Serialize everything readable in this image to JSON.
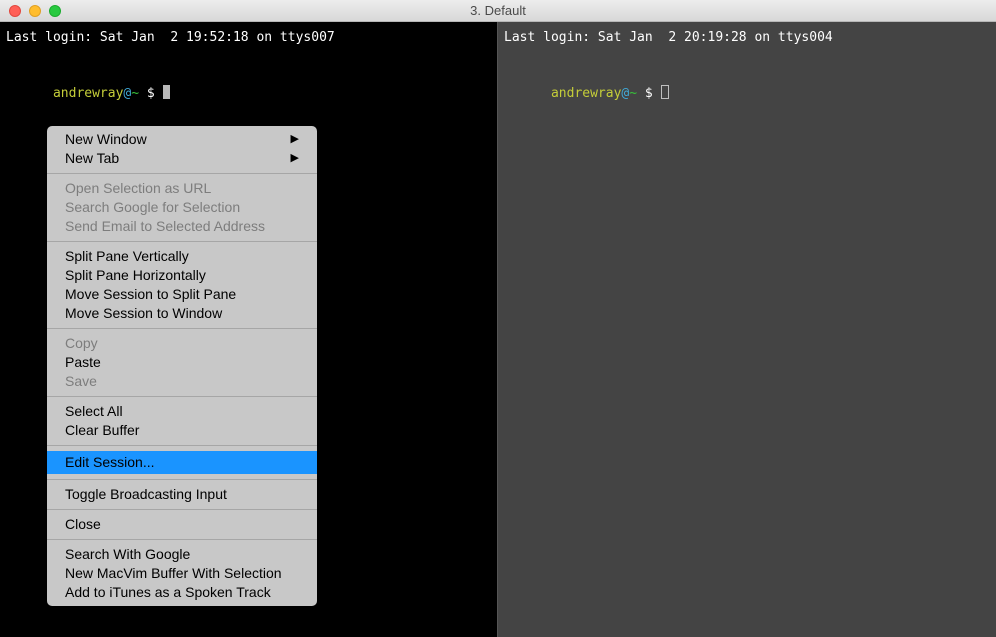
{
  "window": {
    "title": "3. Default"
  },
  "left_pane": {
    "login_line": "Last login: Sat Jan  2 19:52:18 on ttys007",
    "prompt_user": "andrewray",
    "prompt_at": "@",
    "prompt_tilde": "~",
    "prompt_dollar": " $ "
  },
  "right_pane": {
    "login_line": "Last login: Sat Jan  2 20:19:28 on ttys004",
    "prompt_user": "andrewray",
    "prompt_at": "@",
    "prompt_tilde": "~",
    "prompt_dollar": " $ "
  },
  "menu": {
    "groups": [
      [
        {
          "label": "New Window",
          "submenu": true,
          "disabled": false
        },
        {
          "label": "New Tab",
          "submenu": true,
          "disabled": false
        }
      ],
      [
        {
          "label": "Open Selection as URL",
          "disabled": true
        },
        {
          "label": "Search Google for Selection",
          "disabled": true
        },
        {
          "label": "Send Email to Selected Address",
          "disabled": true
        }
      ],
      [
        {
          "label": "Split Pane Vertically",
          "disabled": false
        },
        {
          "label": "Split Pane Horizontally",
          "disabled": false
        },
        {
          "label": "Move Session to Split Pane",
          "disabled": false
        },
        {
          "label": "Move Session to Window",
          "disabled": false
        }
      ],
      [
        {
          "label": "Copy",
          "disabled": true
        },
        {
          "label": "Paste",
          "disabled": false
        },
        {
          "label": "Save",
          "disabled": true
        }
      ],
      [
        {
          "label": "Select All",
          "disabled": false
        },
        {
          "label": "Clear Buffer",
          "disabled": false
        }
      ],
      [
        {
          "label": "Edit Session...",
          "disabled": false,
          "highlight": true
        }
      ],
      [
        {
          "label": "Toggle Broadcasting Input",
          "disabled": false
        }
      ],
      [
        {
          "label": "Close",
          "disabled": false
        }
      ],
      [
        {
          "label": "Search With Google",
          "disabled": false
        },
        {
          "label": "New MacVim Buffer With Selection",
          "disabled": false
        },
        {
          "label": "Add to iTunes as a Spoken Track",
          "disabled": false
        }
      ]
    ]
  }
}
